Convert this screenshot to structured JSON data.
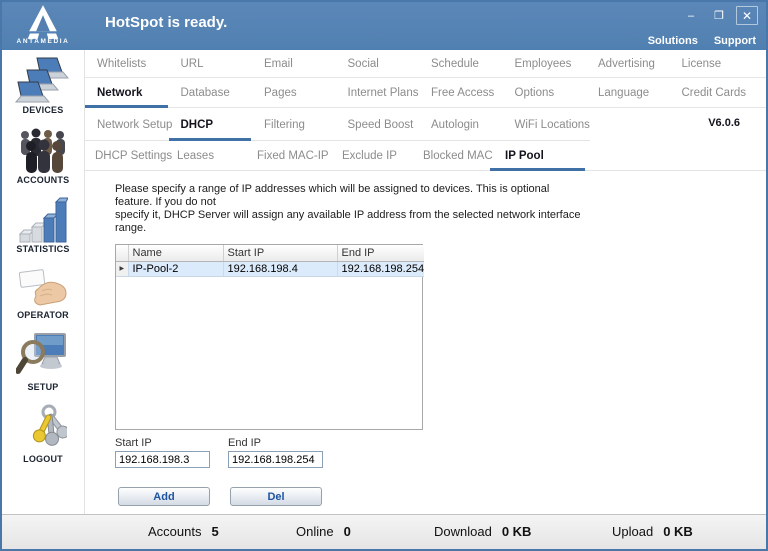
{
  "window": {
    "title": "HotSpot is ready.",
    "brand": "ANTAMEDIA",
    "controls": {
      "minimize": "–",
      "restore": "❐",
      "close": "✕"
    },
    "links": {
      "solutions": "Solutions",
      "support": "Support"
    },
    "version": "V6.0.6"
  },
  "sidebar": {
    "items": [
      {
        "label": "DEVICES",
        "icon": "devices-icon"
      },
      {
        "label": "ACCOUNTS",
        "icon": "accounts-icon"
      },
      {
        "label": "STATISTICS",
        "icon": "statistics-icon"
      },
      {
        "label": "OPERATOR",
        "icon": "operator-icon"
      },
      {
        "label": "SETUP",
        "icon": "setup-icon"
      },
      {
        "label": "LOGOUT",
        "icon": "logout-icon"
      }
    ]
  },
  "menu": {
    "row1": [
      "Whitelists",
      "URL",
      "Email",
      "Social",
      "Schedule",
      "Employees",
      "Advertising",
      "License"
    ],
    "row2": [
      "Network",
      "Database",
      "Pages",
      "Internet Plans",
      "Free Access",
      "Options",
      "Language",
      "Credit Cards"
    ],
    "row3": [
      "Network Setup",
      "DHCP",
      "Filtering",
      "Speed Boost",
      "Autologin",
      "WiFi Locations"
    ],
    "row4": [
      "DHCP Settings",
      "Leases",
      "Fixed MAC-IP",
      "Exclude IP",
      "Blocked MAC",
      "IP Pool"
    ]
  },
  "content": {
    "description": "Please specify a range of IP addresses which will be assigned to devices. This is optional feature. If you do not\nspecify it, DHCP Server will assign any available IP address from the selected network interface range.",
    "table": {
      "headers": [
        "Name",
        "Start IP",
        "End IP"
      ],
      "row_marker": "▶",
      "rows": [
        [
          "IP-Pool-2",
          "192.168.198.4",
          "192.168.198.254"
        ]
      ]
    },
    "form": {
      "start_ip_label": "Start IP",
      "start_ip_value": "192.168.198.3",
      "end_ip_label": "End IP",
      "end_ip_value": "192.168.198.254",
      "add_label": "Add",
      "del_label": "Del"
    }
  },
  "statusbar": {
    "stats": [
      {
        "label": "Accounts",
        "value": "5"
      },
      {
        "label": "Online",
        "value": "0"
      },
      {
        "label": "Download",
        "value": "0 KB"
      },
      {
        "label": "Upload",
        "value": "0 KB"
      }
    ]
  },
  "colors": {
    "titlebar_blue": "#5380b1",
    "window_border": "#4a77a9",
    "active_tab_underline": "#3f70a6",
    "selected_row_bg": "#dcebfb",
    "button_text": "#1d55a0"
  }
}
